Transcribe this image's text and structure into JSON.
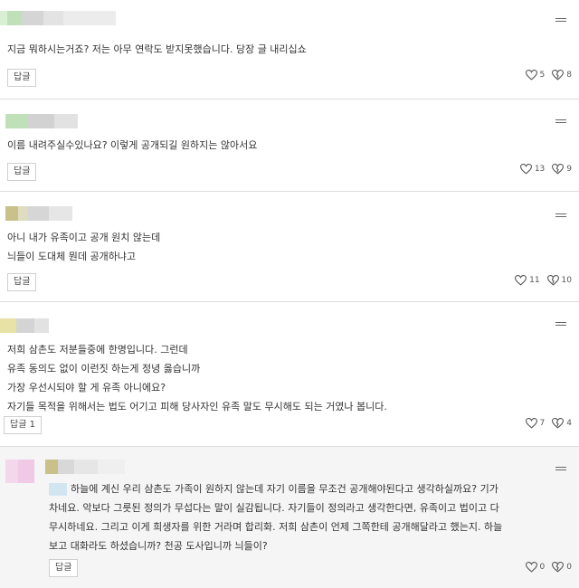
{
  "colors": {
    "avatar_green": "#bfe0b8",
    "avatar_gray": "#d8d8d8",
    "avatar_olive": "#c9c08a",
    "avatar_yellow": "#e9e2a6",
    "avatar_pink": "#efc9e6",
    "highlight_blue": "#d2e6f2"
  },
  "comments": [
    {
      "text": [
        "지금 뭐하시는거죠? 저는 아무 연락도 받지못했습니다. 당장 글 내리십쇼"
      ],
      "reply_label": "답글",
      "likes": "5",
      "dislikes": "8"
    },
    {
      "text": [
        "이름 내려주실수있나요? 이렇게 공개되길 원하지는 않아서요"
      ],
      "reply_label": "답글",
      "likes": "13",
      "dislikes": "9"
    },
    {
      "text": [
        "아니 내가 유족이고 공개 원치 않는데",
        "늬들이 도대체 뭔데 공개하냐고"
      ],
      "reply_label": "답글",
      "likes": "11",
      "dislikes": "10"
    },
    {
      "text": [
        "저희 삼촌도 저분들중에 한명입니다. 그런데",
        "유족 동의도 없이 이런짓 하는게 정녕 옳습니까",
        "가장 우선시되야 할 게 유족 아니에요?",
        "자기들 목적을 위해서는 법도 어기고 피해 당사자인 유족 말도 무시해도 되는 거였나 봅니다."
      ],
      "reply_label": "답글 1",
      "likes": "7",
      "dislikes": "4"
    },
    {
      "text": [
        "하늘에 계신 우리 삼촌도 가족이 원하지 않는데 자기 이름을 무조건 공개해야된다고 생각하실까요? 기가",
        "차네요. 악보다 그릇된 정의가 무섭다는 말이 실감됩니다. 자기들이 정의라고 생각한다면, 유족이고 법이고 다",
        "무시하네요. 그리고 이게 희생자를 위한 거라며 합리화. 저희 삼촌이 언제 그쪽한테 공개해달라고 했는지. 하늘",
        "보고 대화라도 하셨습니까? 천공 도사입니까 늬들이?"
      ],
      "reply_label": "답글",
      "likes": "0",
      "dislikes": "0"
    }
  ]
}
